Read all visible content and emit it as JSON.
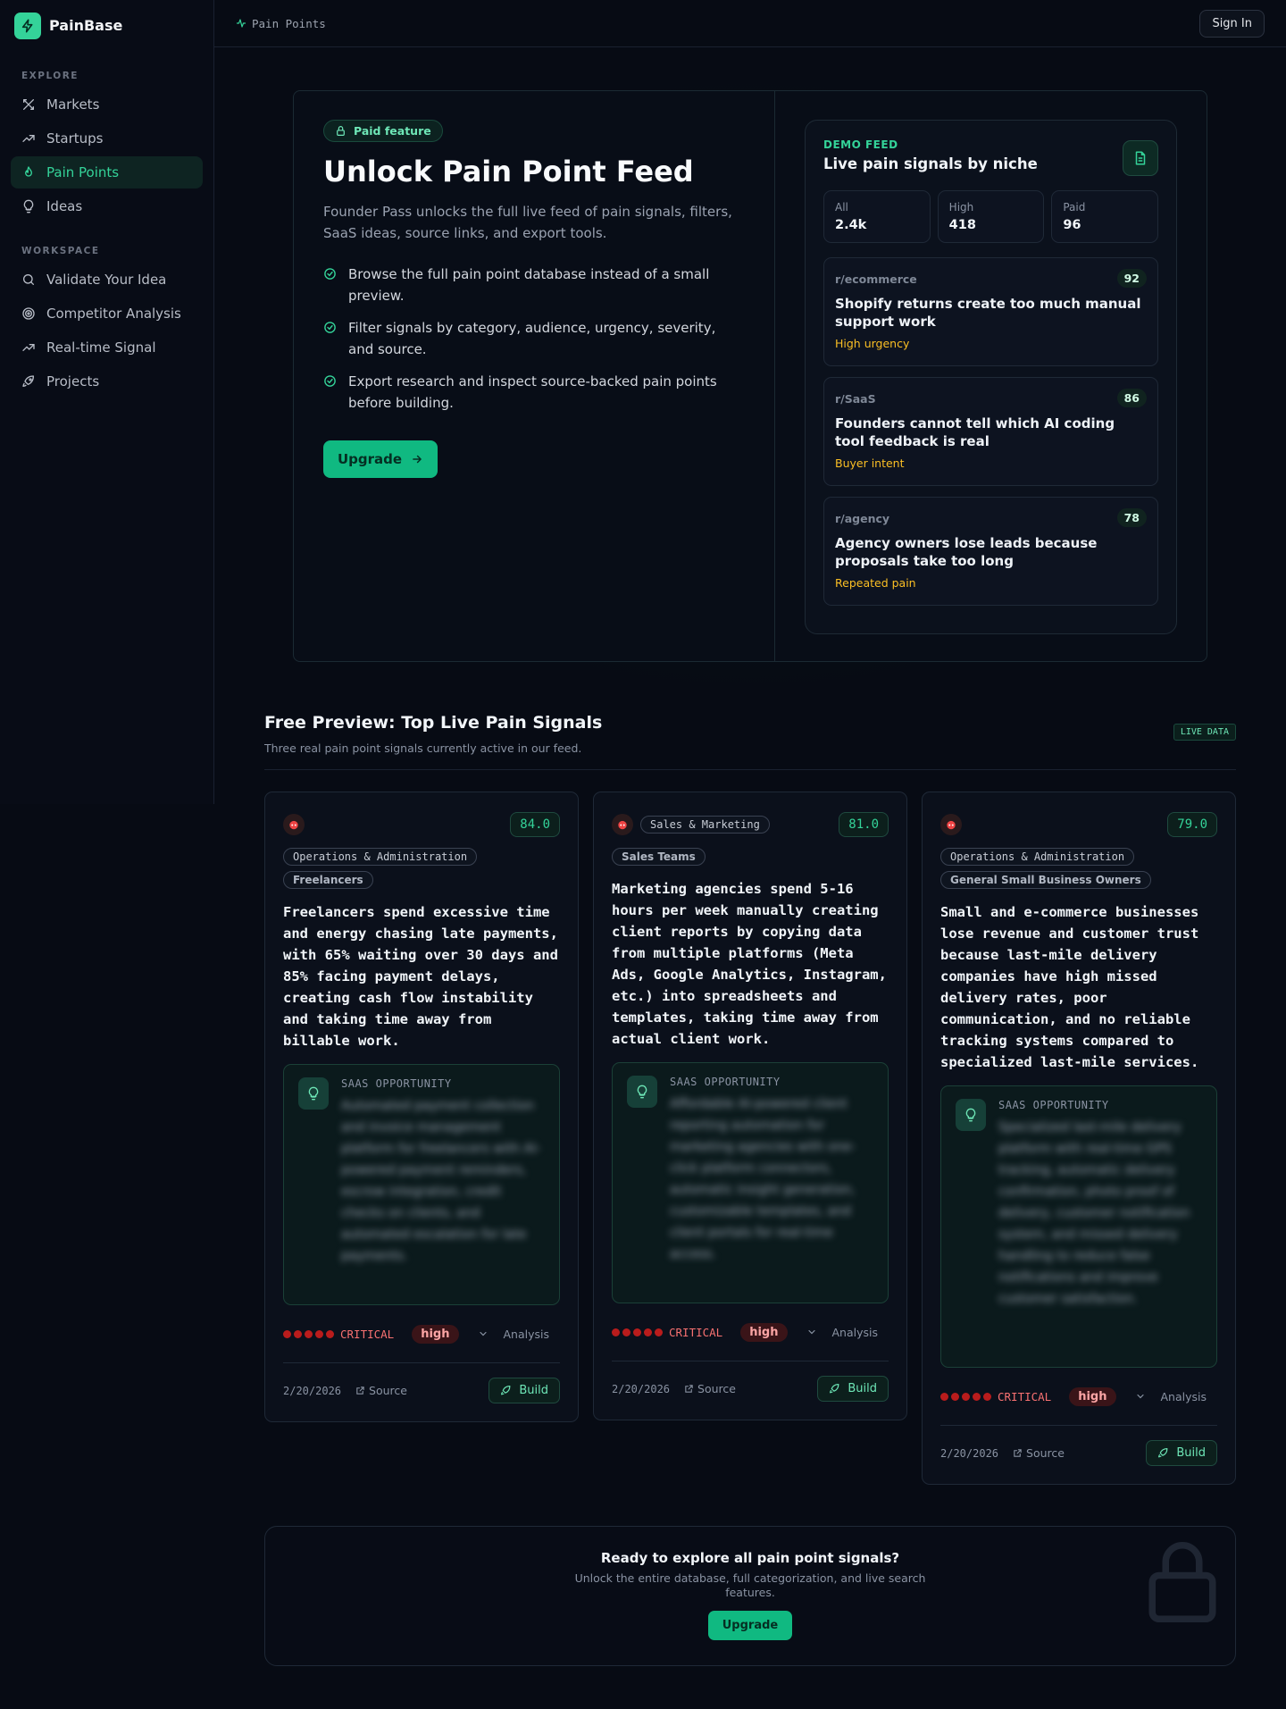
{
  "brand": {
    "name": "PainBase"
  },
  "sidebar": {
    "explore_label": "EXPLORE",
    "explore": [
      {
        "label": "Markets",
        "icon": "x-tools-icon"
      },
      {
        "label": "Startups",
        "icon": "trending-up-icon"
      },
      {
        "label": "Pain Points",
        "icon": "flame-icon",
        "active": true
      },
      {
        "label": "Ideas",
        "icon": "lightbulb-icon"
      }
    ],
    "workspace_label": "WORKSPACE",
    "workspace": [
      {
        "label": "Validate Your Idea",
        "icon": "search-icon"
      },
      {
        "label": "Competitor Analysis",
        "icon": "target-icon"
      },
      {
        "label": "Real-time Signal",
        "icon": "trending-up-icon"
      },
      {
        "label": "Projects",
        "icon": "rocket-icon"
      }
    ]
  },
  "topbar": {
    "crumb": "Pain Points",
    "signin": "Sign In"
  },
  "hero": {
    "badge": "Paid feature",
    "title": "Unlock Pain Point Feed",
    "subtitle": "Founder Pass unlocks the full live feed of pain signals, filters, SaaS ideas, source links, and export tools.",
    "checks": [
      "Browse the full pain point database instead of a small preview.",
      "Filter signals by category, audience, urgency, severity, and source.",
      "Export research and inspect source-backed pain points before building."
    ],
    "cta": "Upgrade"
  },
  "demo": {
    "tag": "DEMO FEED",
    "title": "Live pain signals by niche",
    "stats": [
      {
        "label": "All",
        "value": "2.4k"
      },
      {
        "label": "High",
        "value": "418"
      },
      {
        "label": "Paid",
        "value": "96"
      }
    ],
    "signals": [
      {
        "sub": "r/ecommerce",
        "score": "92",
        "title": "Shopify returns create too much manual support work",
        "tag": "High urgency"
      },
      {
        "sub": "r/SaaS",
        "score": "86",
        "title": "Founders cannot tell which AI coding tool feedback is real",
        "tag": "Buyer intent"
      },
      {
        "sub": "r/agency",
        "score": "78",
        "title": "Agency owners lose leads because proposals take too long",
        "tag": "Repeated pain"
      }
    ]
  },
  "preview": {
    "title": "Free Preview: Top Live Pain Signals",
    "subtitle": "Three real pain point signals currently active in our feed.",
    "live": "LIVE DATA"
  },
  "cards": [
    {
      "score": "84.0",
      "category": "Operations & Administration",
      "audience": "Freelancers",
      "text": "Freelancers spend excessive time and energy chasing late payments, with 65% waiting over 30 days and 85% facing payment delays, creating cash flow instability and taking time away from billable work.",
      "opp_label": "SAAS OPPORTUNITY",
      "opp_text": "Automated payment collection and invoice management platform for freelancers with AI-powered payment reminders, escrow integration, credit checks on clients, and automated escalation for late payments.",
      "severity": "CRITICAL",
      "urgency": "high",
      "analysis": "Analysis",
      "date": "2/20/2026",
      "source": "Source",
      "build": "Build"
    },
    {
      "score": "81.0",
      "category": "Sales & Marketing",
      "audience": "Sales Teams",
      "text": "Marketing agencies spend 5-16 hours per week manually creating client reports by copying data from multiple platforms (Meta Ads, Google Analytics, Instagram, etc.) into spreadsheets and templates, taking time away from actual client work.",
      "opp_label": "SAAS OPPORTUNITY",
      "opp_text": "Affordable AI-powered client reporting automation for marketing agencies with one-click platform connectors, automatic insight generation, customizable templates, and client portals for real-time access.",
      "severity": "CRITICAL",
      "urgency": "high",
      "analysis": "Analysis",
      "date": "2/20/2026",
      "source": "Source",
      "build": "Build"
    },
    {
      "score": "79.0",
      "category": "Operations & Administration",
      "audience": "General Small Business Owners",
      "text": "Small and e-commerce businesses lose revenue and customer trust because last-mile delivery companies have high missed delivery rates, poor communication, and no reliable tracking systems compared to specialized last-mile services.",
      "opp_label": "SAAS OPPORTUNITY",
      "opp_text": "Specialized last-mile delivery platform with real-time GPS tracking, automatic delivery confirmation, photo proof of delivery, customer notification system, and missed delivery handling to reduce false notifications and improve customer satisfaction.",
      "severity": "CRITICAL",
      "urgency": "high",
      "analysis": "Analysis",
      "date": "2/20/2026",
      "source": "Source",
      "build": "Build"
    }
  ],
  "cta": {
    "title": "Ready to explore all pain point signals?",
    "subtitle": "Unlock the entire database, full categorization, and live search features.",
    "button": "Upgrade"
  },
  "colors": {
    "accent": "#10b981",
    "accent_text": "#34d399",
    "critical": "#f87171",
    "urgency": "#fbbf24"
  }
}
